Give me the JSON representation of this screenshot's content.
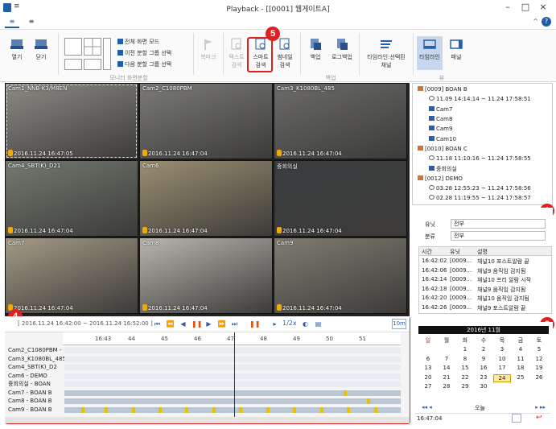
{
  "window": {
    "title": "Playback - [[0001] 웹게이트A]",
    "qa_glyph": "≡",
    "minimize": "–",
    "maximize": "□",
    "close": "×",
    "help": "?",
    "collapse": "^"
  },
  "tabs": [
    {
      "label": "≡"
    },
    {
      "label": "≡"
    }
  ],
  "ribbon": {
    "open": "열기",
    "close": "닫기",
    "fullscreen": "전체 화면 모드",
    "prev_group": "이전 분할 그룹 선택",
    "next_group": "다음 분할 그룹 선택",
    "monitor_group": "모니터 화면분할",
    "bookmark": "북마크",
    "text_search_1": "텍스트",
    "text_search_2": "검색",
    "smart_search_1": "스마트",
    "smart_search_2": "검색",
    "thumb_search_1": "썸네일",
    "thumb_search_2": "검색",
    "backup": "백업",
    "log_backup": "로그백업",
    "backup_group": "백업",
    "timeline_channel_1": "타임라인:선택된",
    "timeline_channel_2": "채널",
    "timeline_view": "타임라인",
    "panel_view": "패널",
    "view_group": "뷰"
  },
  "badges": {
    "b2": "2",
    "b3": "3",
    "b4": "4",
    "b5": "5"
  },
  "cameras": [
    {
      "label": "Cam1_NNB-K3/M8EN",
      "timestamp": "2016.11.24 16:47:05",
      "fill": "#8d8a85"
    },
    {
      "label": "Cam2_C1080PBM",
      "timestamp": "2016.11.24 16:47:04",
      "fill": "#7b7a77"
    },
    {
      "label": "Cam3_K1080BL_485",
      "timestamp": "2016.11.24 16:47:04",
      "fill": "#6c6b6a"
    },
    {
      "label": "Cam4_SBT(K)_D21",
      "timestamp": "2016.11.24 16:47:04",
      "fill": "#737a6f"
    },
    {
      "label": "Cam6",
      "timestamp": "2016.11.24 16:47:04",
      "fill": "#9b8f72"
    },
    {
      "label": "중회의실",
      "timestamp": "2016.11.24 16:47:04",
      "fill": "#3a3c3f"
    },
    {
      "label": "Cam7",
      "timestamp": "2016.11.24 16:47:04",
      "fill": "#a49a86"
    },
    {
      "label": "Cam8",
      "timestamp": "2016.11.24 16:47:04",
      "fill": "#b9b6ae"
    },
    {
      "label": "Cam9",
      "timestamp": "2016.11.24 16:47:04",
      "fill": "#807c70"
    }
  ],
  "timeline": {
    "range": "[ 2016.11.24 16:42:00 ~ 2016.11.24 16:52:00 ]",
    "speed": "1/2x",
    "zoom": "10m",
    "ticks": [
      "16:43",
      "44",
      "45",
      "46",
      "47",
      "48",
      "49",
      "50",
      "51"
    ],
    "controls": {
      "first": "⏮",
      "rewind": "⏪",
      "step_back": "◀",
      "pause": "❚❚",
      "play": "▶",
      "fast_forward": "⏩",
      "last": "⏭",
      "sync_pause": "❚❚",
      "speed_icon": "▸",
      "audio": "◐",
      "snapshot": "▤"
    },
    "rows": [
      {
        "name": "Cam2_C1080PBM -",
        "marks": []
      },
      {
        "name": "Cam3_K1080BL_485",
        "marks": []
      },
      {
        "name": "Cam4_SBT(K)_D2",
        "marks": []
      },
      {
        "name": "Cam6 - DEMO",
        "marks": []
      },
      {
        "name": "중회의실 - BOAN",
        "marks": []
      },
      {
        "name": "Cam7 - BOAN B",
        "marks": [
          0.83
        ]
      },
      {
        "name": "Cam8 - BOAN B",
        "marks": [
          0.9
        ]
      },
      {
        "name": "Cam9 - BOAN B",
        "marks": [
          0.05,
          0.12,
          0.2,
          0.28,
          0.36,
          0.44,
          0.52,
          0.6,
          0.68,
          0.76,
          0.84,
          0.92
        ]
      }
    ]
  },
  "tree": {
    "items": [
      {
        "text": "[0009] BOAN B",
        "indent": 0,
        "kind": "site"
      },
      {
        "text": "11.09 14:14:14 ~ 11.24 17:58:51",
        "indent": 1,
        "kind": "clock"
      },
      {
        "text": "Cam7",
        "indent": 1,
        "kind": "cam"
      },
      {
        "text": "Cam8",
        "indent": 1,
        "kind": "cam"
      },
      {
        "text": "Cam9",
        "indent": 1,
        "kind": "cam"
      },
      {
        "text": "Cam10",
        "indent": 1,
        "kind": "cam"
      },
      {
        "text": "[0010] BOAN C",
        "indent": 0,
        "kind": "site"
      },
      {
        "text": "11.18 11:10:16 ~ 11.24 17:58:55",
        "indent": 1,
        "kind": "clock"
      },
      {
        "text": "중회의실",
        "indent": 1,
        "kind": "cam"
      },
      {
        "text": "[0012] DEMO",
        "indent": 0,
        "kind": "site"
      },
      {
        "text": "03.28 12:55:23 ~ 11.24 17:58:56",
        "indent": 1,
        "kind": "clock"
      },
      {
        "text": "02.28 11:19:55 ~ 11.24 17:58:57",
        "indent": 1,
        "kind": "clock"
      }
    ]
  },
  "events": {
    "type_label": "유닛",
    "type_value": "전부",
    "class_label": "분류",
    "class_value": "전부",
    "columns": [
      "시간",
      "유닛",
      "설명"
    ],
    "rows": [
      [
        "16:42:02",
        "[0009...",
        "채널10 포스트알람 끝"
      ],
      [
        "16:42:06",
        "[0009...",
        "채널9 움직임 감지됨"
      ],
      [
        "16:42:14",
        "[0009...",
        "채널10 프리 알람 시작"
      ],
      [
        "16:42:18",
        "[0009...",
        "채널9 움직임 감지됨"
      ],
      [
        "16:42:20",
        "[0009...",
        "채널10 움직임 감지됨"
      ],
      [
        "16:42:26",
        "[0009...",
        "채널9 포스트알람 끝"
      ]
    ]
  },
  "calendar": {
    "header": "2016년 11월",
    "weekdays": [
      "일",
      "월",
      "화",
      "수",
      "목",
      "금",
      "토"
    ],
    "weeks": [
      [
        "",
        "",
        "1",
        "2",
        "3",
        "4",
        "5"
      ],
      [
        "6",
        "7",
        "8",
        "9",
        "10",
        "11",
        "12"
      ],
      [
        "13",
        "14",
        "15",
        "16",
        "17",
        "18",
        "19"
      ],
      [
        "20",
        "21",
        "22",
        "23",
        "24",
        "25",
        "26"
      ],
      [
        "27",
        "28",
        "29",
        "30",
        "",
        "",
        ""
      ]
    ],
    "selected": "24",
    "today_label": "오늘",
    "prev": "◂◂  ◂",
    "next": "▸  ▸▸",
    "time": "16:47:04",
    "apply": "↩"
  },
  "colors": {
    "accent": "#1f5fa8",
    "badge": "#e02020",
    "event_mark": "#e8c200",
    "timeline_bar": "#b9c7d6"
  }
}
